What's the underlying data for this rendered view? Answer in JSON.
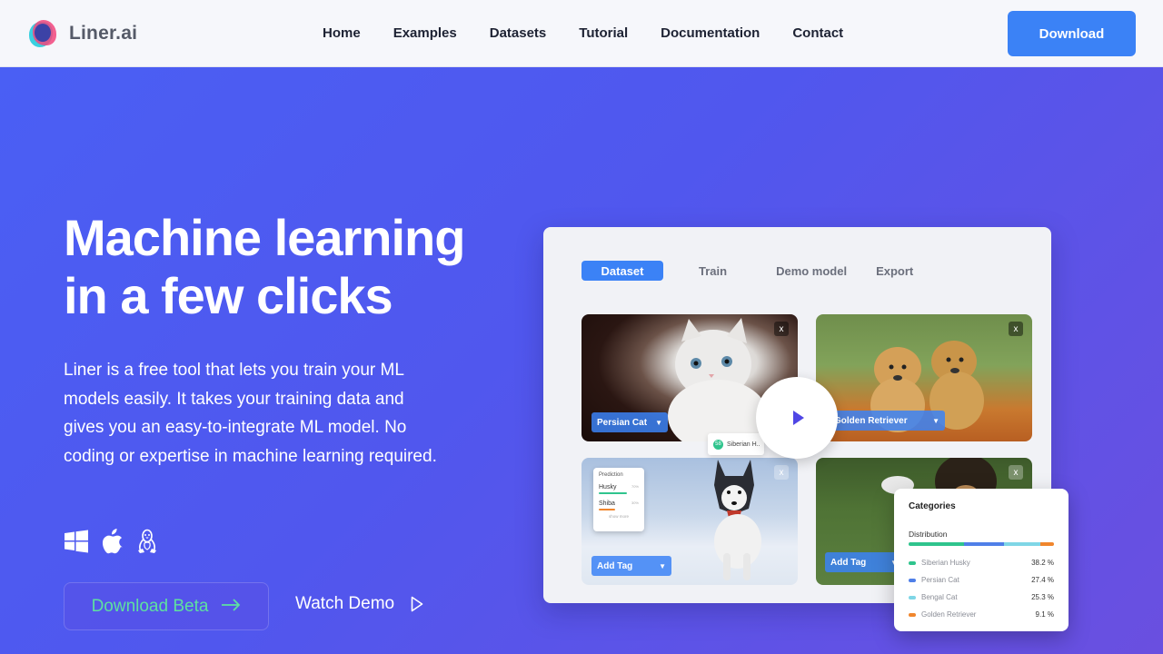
{
  "brand": {
    "name": "Liner.ai"
  },
  "nav": {
    "items": [
      "Home",
      "Examples",
      "Datasets",
      "Tutorial",
      "Documentation",
      "Contact"
    ],
    "download_label": "Download"
  },
  "hero": {
    "title_line1": "Machine learning",
    "title_line2": "in a few clicks",
    "description": "Liner is a free tool that lets you train your ML models easily. It takes your training data and gives you an easy-to-integrate ML model. No coding or expertise in machine learning required.",
    "os_icons": [
      "windows-icon",
      "apple-icon",
      "linux-icon"
    ],
    "cta_primary": "Download Beta",
    "cta_secondary": "Watch Demo"
  },
  "app": {
    "tabs": [
      "Dataset",
      "Train",
      "Demo model",
      "Export"
    ],
    "active_tab": "Dataset",
    "cards": [
      {
        "tag": "Persian Cat"
      },
      {
        "tag": "Golden Retriever"
      },
      {
        "tag": "Add Tag"
      },
      {
        "tag": "Add Tag"
      }
    ],
    "close_label": "x",
    "prediction": {
      "title": "Prediction",
      "rows": [
        {
          "label": "Husky",
          "value": "70%"
        },
        {
          "label": "Shiba",
          "value": "30%"
        }
      ],
      "more": "show more"
    },
    "hover_label": "Siberian H..",
    "hover_badge": "58",
    "categories": {
      "title": "Categories",
      "distribution_label": "Distribution",
      "items": [
        {
          "name": "Siberian Husky",
          "pct": "38.2 %",
          "color": "#2fc48d"
        },
        {
          "name": "Persian Cat",
          "pct": "27.4 %",
          "color": "#4f7fe8"
        },
        {
          "name": "Bengal Cat",
          "pct": "25.3 %",
          "color": "#7fd6e6"
        },
        {
          "name": "Golden Retriever",
          "pct": "9.1 %",
          "color": "#f0862d"
        }
      ]
    }
  },
  "colors": {
    "accent": "#3b82f6",
    "beta_text": "#5ee0a0"
  }
}
